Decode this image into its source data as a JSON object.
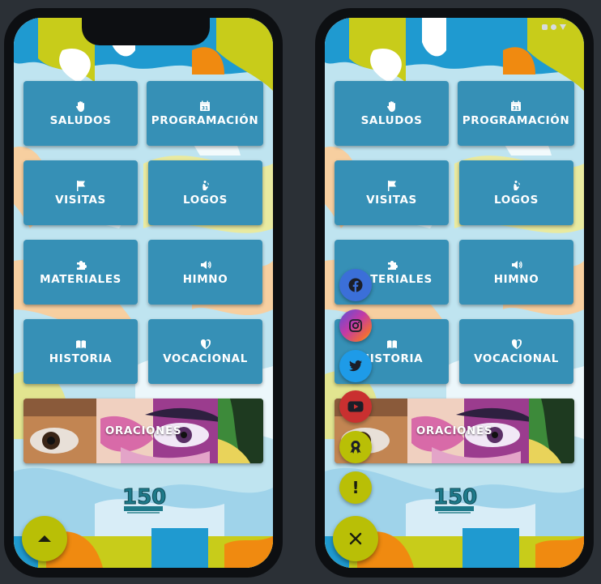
{
  "menu": {
    "saludos": "SALUDOS",
    "programacion": "PROGRAMACIÓN",
    "visitas": "VISITAS",
    "logos": "LOGOS",
    "materiales": "MATERIALES",
    "himno": "HIMNO",
    "historia": "HISTORIA",
    "vocacional": "VOCACIONAL",
    "oraciones": "ORACIONES"
  },
  "icons": {
    "saludos": "hand-icon",
    "programacion": "calendar-icon",
    "visitas": "flag-icon",
    "logos": "hands-icon",
    "materiales": "puzzle-icon",
    "himno": "speaker-icon",
    "historia": "book-icon",
    "vocacional": "heart-shield-icon"
  },
  "calendar_day": "31",
  "logo_text": "150",
  "fab": {
    "exclaim": "!",
    "social": [
      "facebook",
      "instagram",
      "twitter",
      "youtube",
      "award"
    ]
  },
  "colors": {
    "tile": "#3690b6",
    "fab_yellow": "#b9bf06",
    "facebook": "#3b6fd8",
    "twitter": "#1e9be8",
    "youtube": "#c93030",
    "background": "#2b3036"
  }
}
